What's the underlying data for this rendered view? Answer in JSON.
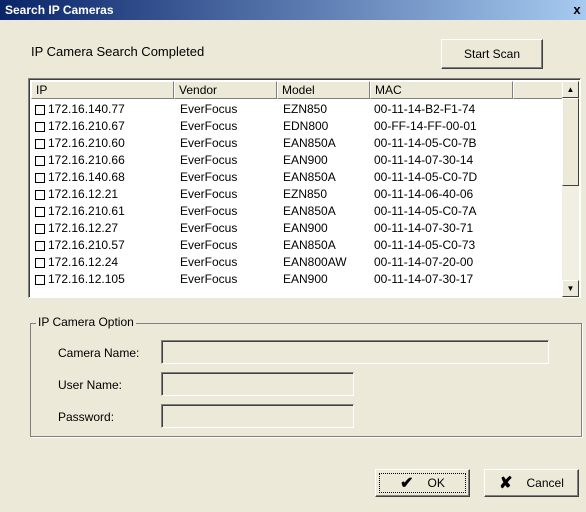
{
  "window": {
    "title": "Search IP Cameras",
    "close": "x"
  },
  "status_text": "IP Camera Search Completed",
  "start_scan_label": "Start Scan",
  "columns": [
    "IP",
    "Vendor",
    "Model",
    "MAC"
  ],
  "rows": [
    {
      "ip": "172.16.140.77",
      "vendor": "EverFocus",
      "model": "EZN850",
      "mac": "00-11-14-B2-F1-74"
    },
    {
      "ip": "172.16.210.67",
      "vendor": "EverFocus",
      "model": "EDN800",
      "mac": "00-FF-14-FF-00-01"
    },
    {
      "ip": "172.16.210.60",
      "vendor": "EverFocus",
      "model": "EAN850A",
      "mac": "00-11-14-05-C0-7B"
    },
    {
      "ip": "172.16.210.66",
      "vendor": "EverFocus",
      "model": "EAN900",
      "mac": "00-11-14-07-30-14"
    },
    {
      "ip": "172.16.140.68",
      "vendor": "EverFocus",
      "model": "EAN850A",
      "mac": "00-11-14-05-C0-7D"
    },
    {
      "ip": "172.16.12.21",
      "vendor": "EverFocus",
      "model": "EZN850",
      "mac": "00-11-14-06-40-06"
    },
    {
      "ip": "172.16.210.61",
      "vendor": "EverFocus",
      "model": "EAN850A",
      "mac": "00-11-14-05-C0-7A"
    },
    {
      "ip": "172.16.12.27",
      "vendor": "EverFocus",
      "model": "EAN900",
      "mac": "00-11-14-07-30-71"
    },
    {
      "ip": "172.16.210.57",
      "vendor": "EverFocus",
      "model": "EAN850A",
      "mac": "00-11-14-05-C0-73"
    },
    {
      "ip": "172.16.12.24",
      "vendor": "EverFocus",
      "model": "EAN800AW",
      "mac": "00-11-14-07-20-00"
    },
    {
      "ip": "172.16.12.105",
      "vendor": "EverFocus",
      "model": "EAN900",
      "mac": "00-11-14-07-30-17"
    }
  ],
  "option_group": {
    "title": "IP Camera Option",
    "camera_name_label": "Camera Name:",
    "user_name_label": "User Name:",
    "password_label": "Password:",
    "camera_name_value": "",
    "user_name_value": "",
    "password_value": ""
  },
  "buttons": {
    "ok": "OK",
    "cancel": "Cancel"
  },
  "icons": {
    "checkbox": "checkbox-icon",
    "scroll_up": "arrow-up-icon",
    "scroll_down": "arrow-down-icon",
    "ok": "checkmark-icon",
    "cancel": "x-icon"
  },
  "colors": {
    "title_start": "#0a246a",
    "title_end": "#a6caf0",
    "background": "#ece9d8"
  }
}
